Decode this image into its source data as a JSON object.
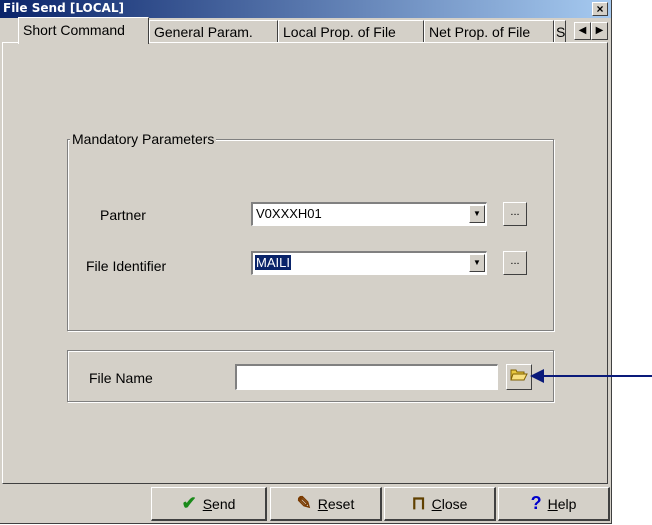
{
  "window": {
    "title": "File Send [LOCAL]",
    "close_label": "×"
  },
  "tabs": [
    {
      "label": "Short Command",
      "active": true
    },
    {
      "label": "General Param."
    },
    {
      "label": "Local Prop. of File"
    },
    {
      "label": "Net Prop. of File"
    },
    {
      "label": "S"
    }
  ],
  "tab_scroll": {
    "left": "◀",
    "right": "▶"
  },
  "mandatory": {
    "legend": "Mandatory Parameters",
    "partner": {
      "label": "Partner",
      "value": "V0XXXH01"
    },
    "file_identifier": {
      "label": "File Identifier",
      "value": "MAILI"
    },
    "browse_label": "..."
  },
  "file_name": {
    "label": "File Name",
    "value": ""
  },
  "buttons": {
    "send": {
      "first": "S",
      "rest": "end",
      "icon": "✔"
    },
    "reset": {
      "first": "R",
      "rest": "eset",
      "icon": "✎"
    },
    "close": {
      "first": "C",
      "rest": "lose",
      "icon": "⊓"
    },
    "help": {
      "first": "H",
      "rest": "elp",
      "icon": "?"
    }
  },
  "colors": {
    "face": "#d4d0c8",
    "title": "#0a246a",
    "arrow": "#0a1a7a",
    "send_icon": "#1a8a1a",
    "help_icon": "#0000cc"
  }
}
